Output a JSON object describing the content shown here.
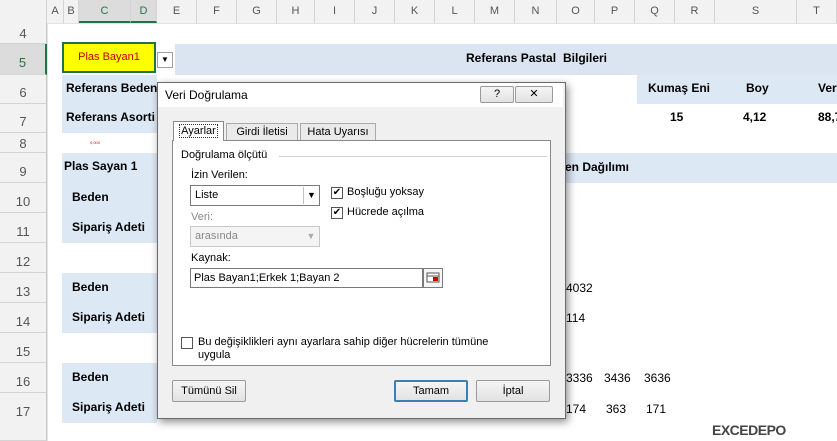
{
  "columns": [
    "A",
    "B",
    "C",
    "D",
    "E",
    "F",
    "G",
    "H",
    "I",
    "J",
    "K",
    "L",
    "M",
    "N",
    "O",
    "P",
    "Q",
    "R",
    "S",
    "T"
  ],
  "rows": [
    "4",
    "5",
    "6",
    "7",
    "8",
    "9",
    "10",
    "11",
    "12",
    "13",
    "14",
    "15",
    "16",
    "17"
  ],
  "cell_c5": "Plas Bayan1",
  "referans_pastal": "Referans Pastal",
  "bilgileri": "Bilgileri",
  "referans_beden": "Referans Beden",
  "referans_asorti": "Referans Asorti",
  "kumas_eni": "Kumaş Eni",
  "boy": "Boy",
  "ver": "Ver",
  "val_kumas": "15",
  "val_boy": "4,12",
  "val_ver": "88,7",
  "plas_sayan": "Plas Sayan 1",
  "dagilimi": "en Dağılımı",
  "beden": "Beden",
  "siparis": "Sipariş Adeti",
  "r13_o": "4032",
  "r14_o": "114",
  "r16": [
    "3336",
    "3436",
    "3636"
  ],
  "r17": [
    "174",
    "363",
    "171"
  ],
  "tiny_red": "0,000",
  "watermark": "EXCEDEPO",
  "dialog": {
    "title": "Veri Doğrulama",
    "help": "?",
    "close": "✕",
    "tabs": [
      "Ayarlar",
      "Girdi İletisi",
      "Hata Uyarısı"
    ],
    "criteria": "Doğrulama ölçütü",
    "izin_label": "İzin Verilen:",
    "izin_value": "Liste",
    "veri_label": "Veri:",
    "veri_value": "arasında",
    "bosluk": "Boşluğu yoksay",
    "hucrede": "Hücrede açılma",
    "kaynak_label": "Kaynak:",
    "kaynak_value": "Plas Bayan1;Erkek 1;Bayan 2",
    "apply_line1": "Bu değişiklikleri aynı ayarlara sahip diğer hücrelerin tümüne",
    "apply_line2": "uygula",
    "clear": "Tümünü Sil",
    "ok": "Tamam",
    "cancel": "İptal"
  }
}
